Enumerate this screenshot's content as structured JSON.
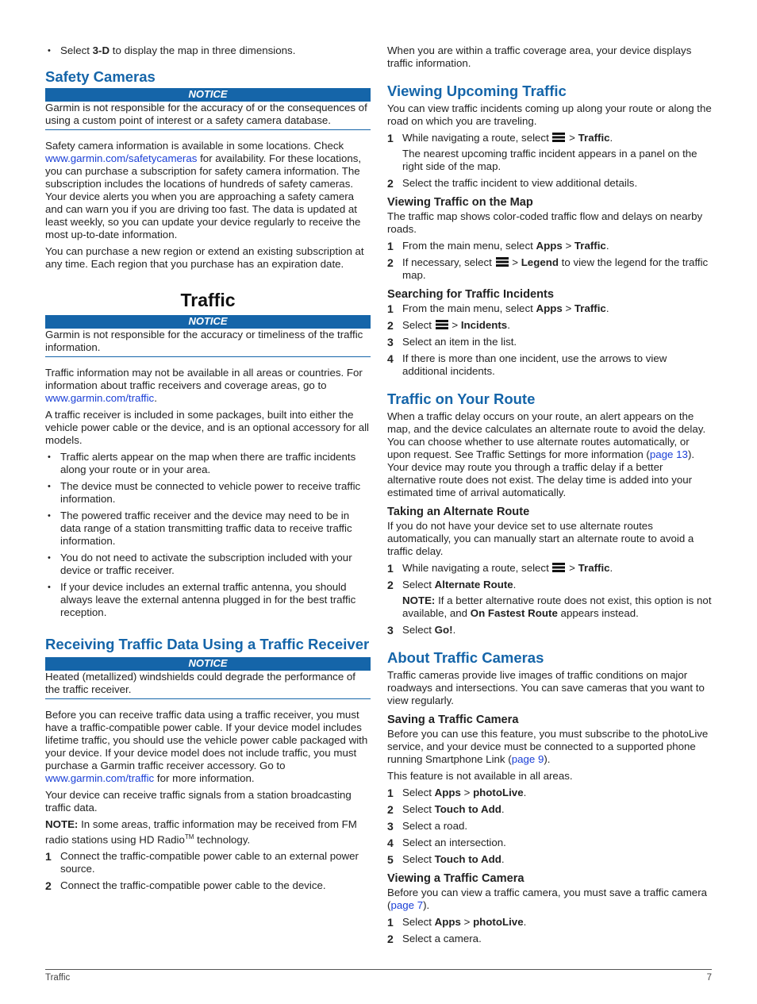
{
  "left": {
    "intro_bullet": {
      "pre": "Select ",
      "bold": "3-D",
      "post": " to display the map in three dimensions."
    },
    "safety": {
      "title": "Safety Cameras",
      "notice_label": "NOTICE",
      "notice_text": "Garmin is not responsible for the accuracy of or the consequences of using a custom point of interest or a safety camera database.",
      "p1_pre": "Safety camera information is available in some locations. Check ",
      "p1_link": "www.garmin.com/safetycameras",
      "p1_post": " for availability. For these locations, you can purchase a subscription for safety camera information. The subscription includes the locations of hundreds of safety cameras. Your device alerts you when you are approaching a safety camera and can warn you if you are driving too fast. The data is updated at least weekly, so you can update your device regularly to receive the most up-to-date information.",
      "p2": "You can purchase a new region or extend an existing subscription at any time. Each region that you purchase has an expiration date."
    },
    "traffic": {
      "title": "Traffic",
      "notice_label": "NOTICE",
      "notice_text": "Garmin is not responsible for the accuracy or timeliness of the traffic information.",
      "p1_pre": "Traffic information may not be available in all areas or countries. For information about traffic receivers and coverage areas, go to ",
      "p1_link": "www.garmin.com/traffic",
      "p1_post": ".",
      "p2": "A traffic receiver is included in some packages, built into either the vehicle power cable or the device, and is an optional accessory for all models.",
      "bullets": [
        "Traffic alerts appear on the map when there are traffic incidents along your route or in your area.",
        "The device must be connected to vehicle power to receive traffic information.",
        "The powered traffic receiver and the device may need to be in data range of a station transmitting traffic data to receive traffic information.",
        "You do not need to activate the subscription included with your device or traffic receiver.",
        "If your device includes an external traffic antenna, you should always leave the external antenna plugged in for the best traffic reception."
      ]
    },
    "receiving": {
      "title": "Receiving Traffic Data Using a Traffic Receiver",
      "notice_label": "NOTICE",
      "notice_text": "Heated (metallized) windshields could degrade the performance of the traffic receiver.",
      "p1_pre": "Before you can receive traffic data using a traffic receiver, you must have a traffic-compatible power cable. If your device model includes lifetime traffic, you should use the vehicle power cable packaged with your device. If your device model does not include traffic, you must purchase a Garmin traffic receiver accessory. Go to ",
      "p1_link": "www.garmin.com/traffic",
      "p1_post": " for more information.",
      "p2": "Your device can receive traffic signals from a station broadcasting traffic data.",
      "note_label": "NOTE:",
      "note_text": " In some areas, traffic information may be received from FM radio stations using HD Radio",
      "note_tm": "TM",
      "note_end": " technology.",
      "steps": [
        "Connect the traffic-compatible power cable to an external power source.",
        "Connect the traffic-compatible power cable to the device."
      ]
    }
  },
  "right": {
    "intro": "When you are within a traffic coverage area, your device displays traffic information.",
    "upcoming": {
      "title": "Viewing Upcoming Traffic",
      "p1": "You can view traffic incidents coming up along your route or along the road on which you are traveling.",
      "step1_pre": "While navigating a route, select ",
      "step1_bold": "Traffic",
      "step1_sub": "The nearest upcoming traffic incident appears in a panel on the right side of the map.",
      "step2": "Select the traffic incident to view additional details."
    },
    "on_map": {
      "title": "Viewing Traffic on the Map",
      "p1": "The traffic map shows color-coded traffic flow and delays on nearby roads.",
      "step1_pre": "From the main menu, select ",
      "step1_b1": "Apps",
      "step1_b2": "Traffic",
      "step2_pre": "If necessary, select ",
      "step2_bold": "Legend",
      "step2_post": " to view the legend for the traffic map."
    },
    "searching": {
      "title": "Searching for Traffic Incidents",
      "step1_pre": "From the main menu, select ",
      "step1_b1": "Apps",
      "step1_b2": "Traffic",
      "step2_pre": "Select ",
      "step2_bold": "Incidents",
      "step3": "Select an item in the list.",
      "step4": "If there is more than one incident, use the arrows to view additional incidents."
    },
    "on_route": {
      "title": "Traffic on Your Route",
      "p1_pre": "When a traffic delay occurs on your route, an alert appears on the map, and the device calculates an alternate route to avoid the delay. You can choose whether to use alternate routes automatically, or upon request. See Traffic Settings for more information (",
      "p1_link": "page 13",
      "p1_post": "). Your device may route you through a traffic delay if a better alternative route does not exist. The delay time is added into your estimated time of arrival automatically."
    },
    "alternate": {
      "title": "Taking an Alternate Route",
      "p1": "If you do not have your device set to use alternate routes automatically, you can manually start an alternate route to avoid a traffic delay.",
      "step1_pre": "While navigating a route, select ",
      "step1_bold": "Traffic",
      "step2_pre": "Select ",
      "step2_bold": "Alternate Route",
      "note_label": "NOTE:",
      "note_pre": " If a better alternative route does not exist, this option is not available, and ",
      "note_bold": "On Fastest Route",
      "note_post": " appears instead.",
      "step3_pre": "Select ",
      "step3_bold": "Go!"
    },
    "cameras": {
      "title": "About Traffic Cameras",
      "p1": "Traffic cameras provide live images of traffic conditions on major roadways and intersections. You can save cameras that you want to view regularly."
    },
    "saving": {
      "title": "Saving a Traffic Camera",
      "p1_pre": "Before you can use this feature, you must subscribe to the photoLive service, and your device must be connected to a supported phone running Smartphone Link (",
      "p1_link": "page 9",
      "p1_post": ").",
      "p2": "This feature is not available in all areas.",
      "step1_b1": "Apps",
      "step1_b2": "photoLive",
      "step2_bold": "Touch to Add",
      "step3": "Select a road.",
      "step4": "Select an intersection.",
      "step5_bold": "Touch to Add"
    },
    "viewing_cam": {
      "title": "Viewing a Traffic Camera",
      "p1_pre": "Before you can view a traffic camera, you must save a traffic camera (",
      "p1_link": "page 7",
      "p1_post": ").",
      "step1_b1": "Apps",
      "step1_b2": "photoLive",
      "step2": "Select a camera."
    }
  },
  "common": {
    "select": "Select ",
    "gt": " > ",
    "dot": "."
  },
  "footer": {
    "section": "Traffic",
    "page": "7"
  }
}
